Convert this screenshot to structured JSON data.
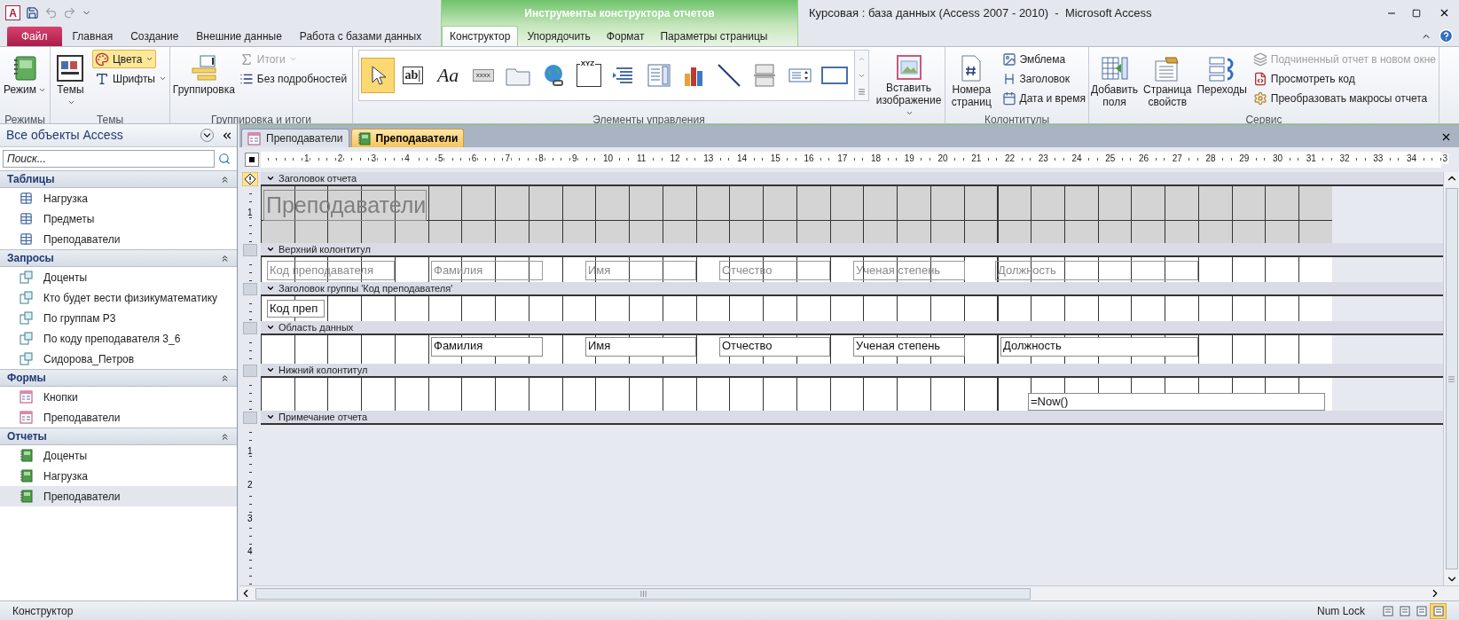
{
  "quick_access": {
    "logo_letter": "A"
  },
  "window": {
    "title": "Курсовая : база данных (Access 2007 - 2010)  -  Microsoft Access",
    "context_title": "Инструменты конструктора отчетов"
  },
  "ribbon_tabs": [
    {
      "label": "Файл",
      "kind": "file",
      "selected": false
    },
    {
      "label": "Главная",
      "kind": "main",
      "selected": false
    },
    {
      "label": "Создание",
      "kind": "main",
      "selected": false
    },
    {
      "label": "Внешние данные",
      "kind": "main",
      "selected": false
    },
    {
      "label": "Работа с базами данных",
      "kind": "main",
      "selected": false
    },
    {
      "label": "Конструктор",
      "kind": "context",
      "selected": true
    },
    {
      "label": "Упорядочить",
      "kind": "context",
      "selected": false
    },
    {
      "label": "Формат",
      "kind": "context",
      "selected": false
    },
    {
      "label": "Параметры страницы",
      "kind": "context",
      "selected": false
    }
  ],
  "ribbon_groups": [
    {
      "label": "Режимы",
      "columns": [
        [
          {
            "label": "Режим",
            "kind": "large",
            "dropdown": true,
            "disabled": false,
            "highlighted": false
          }
        ]
      ]
    },
    {
      "label": "Темы",
      "columns": [
        [
          {
            "label": "Темы",
            "kind": "large",
            "dropdown": true,
            "disabled": false,
            "highlighted": false
          }
        ],
        [
          {
            "label": "Цвета",
            "kind": "small",
            "dropdown": true,
            "disabled": false,
            "highlighted": true
          },
          {
            "label": "Шрифты",
            "kind": "small",
            "dropdown": true,
            "disabled": false,
            "highlighted": false
          }
        ]
      ]
    },
    {
      "label": "Группировка и итоги",
      "columns": [
        [
          {
            "label": "Группировка",
            "kind": "large",
            "dropdown": false,
            "disabled": false,
            "highlighted": false
          }
        ],
        [
          {
            "label": "Итоги",
            "kind": "small",
            "dropdown": true,
            "disabled": true,
            "highlighted": false
          },
          {
            "label": "Без подробностей",
            "kind": "small",
            "dropdown": false,
            "disabled": false,
            "highlighted": false
          }
        ]
      ]
    },
    {
      "label": "Элементы управления",
      "gallery": [
        {
          "kind": "pointer",
          "selected": true
        },
        {
          "kind": "text-box",
          "glyph": "ab|",
          "selected": false
        },
        {
          "kind": "label",
          "glyph": "Aa",
          "selected": false
        },
        {
          "kind": "button",
          "glyph": "xxxx",
          "selected": false
        },
        {
          "kind": "tab-control",
          "selected": false
        },
        {
          "kind": "hyperlink",
          "selected": false
        },
        {
          "kind": "frame",
          "glyph": "XYZ",
          "selected": false
        },
        {
          "kind": "navigation",
          "selected": false
        },
        {
          "kind": "combo-box",
          "selected": false
        },
        {
          "kind": "chart",
          "selected": false
        },
        {
          "kind": "line",
          "selected": false
        },
        {
          "kind": "page-break",
          "selected": false
        },
        {
          "kind": "list-box",
          "selected": false
        },
        {
          "kind": "rectangle",
          "selected": false
        }
      ],
      "columns": [
        [
          {
            "label": "Вставить изображение",
            "kind": "large",
            "dropdown": true,
            "disabled": false,
            "highlighted": false
          }
        ]
      ]
    },
    {
      "label": "Колонтитулы",
      "columns": [
        [
          {
            "label": "Номера страниц",
            "kind": "large",
            "dropdown": false,
            "disabled": false,
            "highlighted": false
          }
        ],
        [
          {
            "label": "Эмблема",
            "kind": "small",
            "dropdown": false,
            "disabled": false,
            "highlighted": false
          },
          {
            "label": "Заголовок",
            "kind": "small",
            "dropdown": false,
            "disabled": false,
            "highlighted": false
          },
          {
            "label": "Дата и время",
            "kind": "small",
            "dropdown": false,
            "disabled": false,
            "highlighted": false
          }
        ]
      ]
    },
    {
      "label": "Сервис",
      "columns": [
        [
          {
            "label": "Добавить поля",
            "kind": "large",
            "dropdown": false,
            "disabled": false,
            "highlighted": false
          }
        ],
        [
          {
            "label": "Страница свойств",
            "kind": "large",
            "dropdown": false,
            "disabled": false,
            "highlighted": false
          }
        ],
        [
          {
            "label": "Переходы",
            "kind": "large",
            "dropdown": false,
            "disabled": false,
            "highlighted": false
          }
        ],
        [
          {
            "label": "Подчиненный отчет в новом окне",
            "kind": "small",
            "dropdown": false,
            "disabled": true,
            "highlighted": false
          },
          {
            "label": "Просмотреть код",
            "kind": "small",
            "dropdown": false,
            "disabled": false,
            "highlighted": false
          },
          {
            "label": "Преобразовать макросы отчета",
            "kind": "small",
            "dropdown": false,
            "disabled": false,
            "highlighted": false
          }
        ]
      ]
    }
  ],
  "nav_pane": {
    "title": "Все объекты Access",
    "search": {
      "placeholder": "Поиск..."
    },
    "groups": [
      {
        "title": "Таблицы",
        "kind": "table",
        "items": [
          {
            "label": "Нагрузка",
            "selected": false
          },
          {
            "label": "Предметы",
            "selected": false
          },
          {
            "label": "Преподаватели",
            "selected": false
          }
        ]
      },
      {
        "title": "Запросы",
        "kind": "query",
        "items": [
          {
            "label": "Доценты",
            "selected": false
          },
          {
            "label": "Кто будет вести физикуматематику",
            "selected": false
          },
          {
            "label": "По группам Р3",
            "selected": false
          },
          {
            "label": "По коду преподавателя 3_6",
            "selected": false
          },
          {
            "label": "Сидорова_Петров",
            "selected": false
          }
        ]
      },
      {
        "title": "Формы",
        "kind": "form",
        "items": [
          {
            "label": "Кнопки",
            "selected": false
          },
          {
            "label": "Преподаватели",
            "selected": false
          }
        ]
      },
      {
        "title": "Отчеты",
        "kind": "report",
        "items": [
          {
            "label": "Доценты",
            "selected": false
          },
          {
            "label": "Нагрузка",
            "selected": false
          },
          {
            "label": "Преподаватели",
            "selected": true
          }
        ]
      }
    ]
  },
  "document_tabs": [
    {
      "label": "Преподаватели",
      "kind": "form",
      "selected": false
    },
    {
      "label": "Преподаватели",
      "kind": "report",
      "selected": true
    }
  ],
  "ruler": {
    "labels": [
      "1",
      "2",
      "3",
      "4",
      "5",
      "6",
      "7",
      "8",
      "9",
      "10",
      "11",
      "12",
      "13",
      "14",
      "15",
      "16",
      "17",
      "18",
      "19",
      "20",
      "21",
      "22",
      "23",
      "24",
      "25",
      "26",
      "27",
      "28",
      "29",
      "30",
      "31",
      "32",
      "33",
      "34",
      "3"
    ]
  },
  "sections": [
    {
      "title": "Заголовок отчета",
      "shaded": true,
      "ruler_label": "1",
      "controls": [
        {
          "kind": "title",
          "text": "Преподаватели"
        }
      ]
    },
    {
      "title": "Верхний колонтитул",
      "shaded": false,
      "controls": [
        {
          "kind": "label",
          "text": "Код преподавателя"
        },
        {
          "kind": "label",
          "text": "Фамилия"
        },
        {
          "kind": "label",
          "text": "Имя"
        },
        {
          "kind": "label",
          "text": "Отчество"
        },
        {
          "kind": "label",
          "text": "Ученая степень"
        },
        {
          "kind": "label",
          "text": "Должность"
        }
      ]
    },
    {
      "title": "Заголовок группы 'Код преподавателя'",
      "shaded": false,
      "controls": [
        {
          "kind": "textbox",
          "text": "Код преп"
        }
      ]
    },
    {
      "title": "Область данных",
      "shaded": false,
      "controls": [
        {
          "kind": "textbox",
          "text": "Фамилия"
        },
        {
          "kind": "textbox",
          "text": "Имя"
        },
        {
          "kind": "textbox",
          "text": "Отчество"
        },
        {
          "kind": "textbox",
          "text": "Ученая степень"
        },
        {
          "kind": "textbox",
          "text": "Должность"
        }
      ]
    },
    {
      "title": "Нижний колонтитул",
      "shaded": false,
      "controls": [
        {
          "kind": "textbox",
          "text": "=Now()"
        }
      ]
    },
    {
      "title": "Примечание отчета",
      "shaded": false
    }
  ],
  "empty_area": {
    "ruler_labels": [
      "1",
      "2",
      "3",
      "4"
    ]
  },
  "status_bar": {
    "mode": "Конструктор",
    "indicators": [
      "Num Lock"
    ],
    "views": [
      {
        "selected": false
      },
      {
        "selected": false
      },
      {
        "selected": false
      },
      {
        "selected": true
      }
    ]
  }
}
